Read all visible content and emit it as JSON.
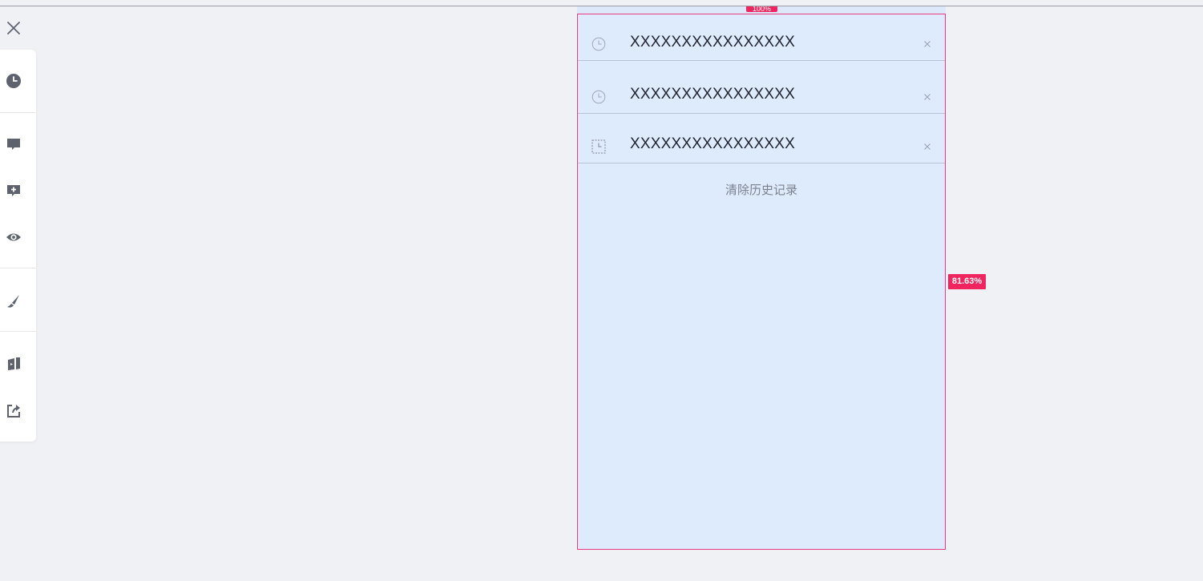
{
  "toolbar": {
    "items": [
      {
        "icon": "clock-icon"
      },
      {
        "icon": "comment-icon"
      },
      {
        "icon": "add-comment-icon"
      },
      {
        "icon": "eye-icon"
      },
      {
        "icon": "brush-icon"
      },
      {
        "icon": "cards-icon"
      },
      {
        "icon": "share-icon"
      }
    ]
  },
  "panel": {
    "top_badge": "100%",
    "side_badge": "81.63%",
    "history": [
      {
        "text": "XXXXXXXXXXXXXXXX"
      },
      {
        "text": "XXXXXXXXXXXXXXXX"
      },
      {
        "text": "XXXXXXXXXXXXXXXX"
      }
    ],
    "clear_label": "清除历史记录"
  },
  "colors": {
    "accent": "#f0245e",
    "panel_bg": "#deebfc",
    "page_bg": "#f0f1f5"
  }
}
